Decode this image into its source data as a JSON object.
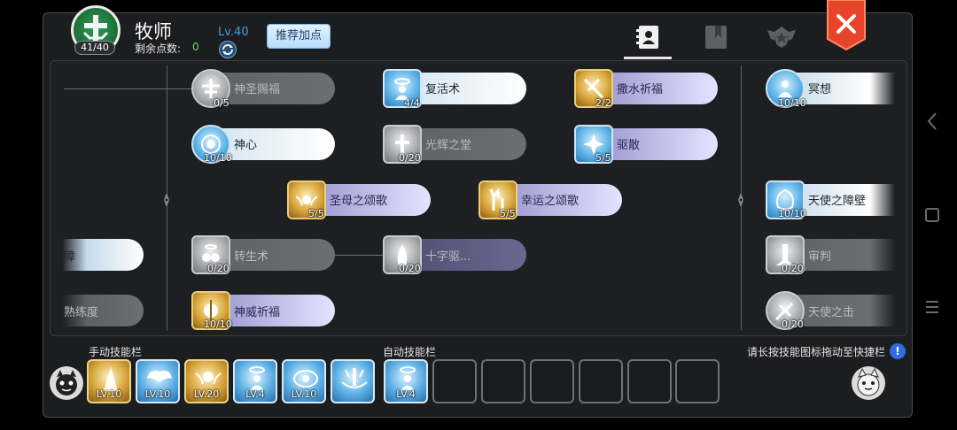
{
  "header": {
    "class_name": "牧师",
    "skill_points_bar": "41/40",
    "remaining_label": "剩余点数:",
    "remaining_value": "0",
    "level": "Lv.40",
    "recommend_button": "推荐加点"
  },
  "tabs": [
    "skills-tab",
    "book-tab",
    "guild-tab"
  ],
  "skills": [
    {
      "name": "神圣赐福",
      "level": "0/5",
      "style": "gray"
    },
    {
      "name": "复活术",
      "level": "4/4",
      "style": "white"
    },
    {
      "name": "撒水祈福",
      "level": "2/2",
      "style": "purple"
    },
    {
      "name": "冥想",
      "level": "10/10",
      "style": "white"
    },
    {
      "name": "神心",
      "level": "10/10",
      "style": "white"
    },
    {
      "name": "光辉之堂",
      "level": "0/20",
      "style": "gray"
    },
    {
      "name": "驱散",
      "level": "5/5",
      "style": "purple"
    },
    {
      "name": "圣母之颂歌",
      "level": "5/5",
      "style": "purple"
    },
    {
      "name": "幸运之颂歌",
      "level": "5/5",
      "style": "purple"
    },
    {
      "name": "天使之障壁",
      "level": "10/10",
      "style": "white"
    },
    {
      "name": "障",
      "level": "",
      "style": "white"
    },
    {
      "name": "转生术",
      "level": "0/20",
      "style": "gray"
    },
    {
      "name": "十字驱...",
      "level": "0/20",
      "style": "dkpurple"
    },
    {
      "name": "审判",
      "level": "0/20",
      "style": "gray"
    },
    {
      "name": "熟练度",
      "level": "",
      "style": "gray"
    },
    {
      "name": "神威祈福",
      "level": "10/10",
      "style": "purple"
    },
    {
      "name": "天使之击",
      "level": "0/20",
      "style": "gray"
    }
  ],
  "manual_bar": {
    "label": "手动技能栏",
    "slots": [
      {
        "level": "LV.10",
        "style": "gold"
      },
      {
        "level": "LV.10",
        "style": "blue"
      },
      {
        "level": "LV.20",
        "style": "gold"
      },
      {
        "level": "LV.4",
        "style": "blue"
      },
      {
        "level": "LV.10",
        "style": "blue"
      },
      {
        "level": "",
        "style": "blue"
      }
    ]
  },
  "auto_bar": {
    "label": "自动技能栏",
    "slots": [
      {
        "level": "LV.4",
        "style": "blue"
      },
      {
        "level": "",
        "style": "empty"
      },
      {
        "level": "",
        "style": "empty"
      },
      {
        "level": "",
        "style": "empty"
      },
      {
        "level": "",
        "style": "empty"
      },
      {
        "level": "",
        "style": "empty"
      },
      {
        "level": "",
        "style": "empty"
      }
    ]
  },
  "hint": "请长按技能图标拖动至快捷栏",
  "colors": {
    "accent_blue": "#4c9bd8",
    "remaining_green": "#6fd36a",
    "close_red": "#e8442a"
  }
}
